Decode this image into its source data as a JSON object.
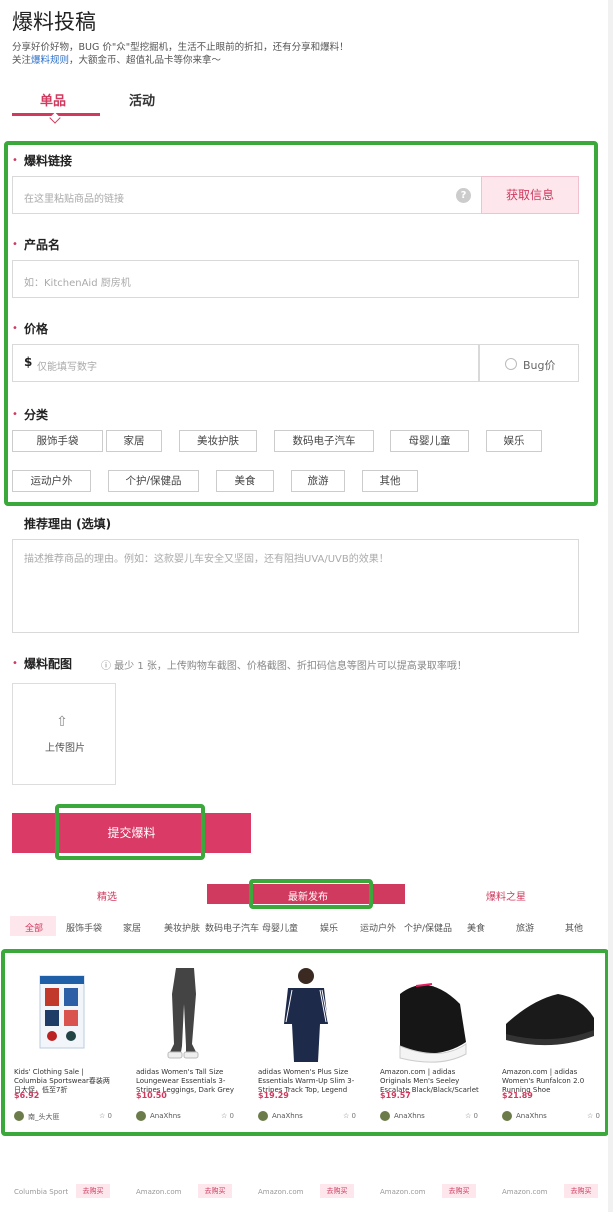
{
  "header": {
    "title": "爆料投稿",
    "intro_line1": "分享好价好物，BUG 价\"众\"型挖掘机，生活不止眼前的折扣，还有分享和爆料！",
    "intro_line2_prefix": "关注",
    "intro_link": "爆料规则",
    "intro_line2_suffix": "，大额金币、超值礼品卡等你来拿～"
  },
  "tabs": [
    {
      "label": "单品",
      "active": true
    },
    {
      "label": "活动",
      "active": false
    }
  ],
  "form": {
    "link": {
      "label": "爆料链接",
      "placeholder": "在这里粘贴商品的链接",
      "help": "?",
      "fetch_button": "获取信息"
    },
    "product": {
      "label": "产品名",
      "placeholder": "如：KitchenAid 厨房机"
    },
    "price": {
      "label": "价格",
      "currency": "$",
      "placeholder": "仅能填写数字",
      "bug_label": "Bug价"
    },
    "category": {
      "label": "分类",
      "options": [
        "服饰手袋",
        "家居",
        "美妆护肤",
        "数码电子汽车",
        "母婴儿童",
        "娱乐",
        "运动户外",
        "个护/保健品",
        "美食",
        "旅游",
        "其他"
      ]
    },
    "reason": {
      "label": "推荐理由 (选填)",
      "placeholder": "描述推荐商品的理由。例如：这款婴儿车安全又坚固，还有阻挡UVA/UVB的效果！"
    },
    "images": {
      "label": "爆料配图",
      "hint": "ⓘ  最少 1 张，上传购物车截图、价格截图、折扣码信息等图片可以提高录取率哦！",
      "upload_label": "上传图片"
    },
    "submit": "提交爆料"
  },
  "feed": {
    "tabs": [
      "精选",
      "最新发布",
      "爆料之星"
    ],
    "active_tab": "最新发布",
    "categories": [
      "全部",
      "服饰手袋",
      "家居",
      "美妆护肤",
      "数码电子汽车",
      "母婴儿童",
      "娱乐",
      "运动户外",
      "个护/保健品",
      "美食",
      "旅游",
      "其他"
    ],
    "active_category": "全部",
    "cards": [
      {
        "title": "Kids' Clothing Sale | Columbia Sportswear春装两日大促，低至7折",
        "price": "$6.92",
        "user": "南_头大匪",
        "favs": "☆ 0"
      },
      {
        "title": "adidas Women's Tall Size Loungewear Essentials 3-Stripes Leggings, Dark Grey",
        "price": "$10.50",
        "user": "AnaXhns",
        "favs": "☆ 0"
      },
      {
        "title": "adidas Women's Plus Size Essentials Warm-Up Slim 3-Stripes Track Top, Legend Ink",
        "price": "$19.29",
        "user": "AnaXhns",
        "favs": "☆ 0"
      },
      {
        "title": "Amazon.com | adidas Originals Men's Seeley Escalate Black/Black/Scarlet",
        "price": "$19.57",
        "user": "AnaXhns",
        "favs": "☆ 0"
      },
      {
        "title": "Amazon.com | adidas Women's Runfalcon 2.0 Running Shoe",
        "price": "$21.89",
        "user": "AnaXhns",
        "favs": "☆ 0"
      }
    ],
    "cards_row2": [
      {
        "store": "Columbia Sport",
        "buy": "去购买"
      },
      {
        "store": "Amazon.com",
        "buy": "去购买"
      },
      {
        "store": "Amazon.com",
        "buy": "去购买"
      },
      {
        "store": "Amazon.com",
        "buy": "去购买"
      },
      {
        "store": "Amazon.com",
        "buy": "去购买"
      }
    ]
  },
  "colors": {
    "accent": "#d03a5e",
    "highlight_box": "#3aa83a",
    "submit_bg": "#d93a66"
  }
}
